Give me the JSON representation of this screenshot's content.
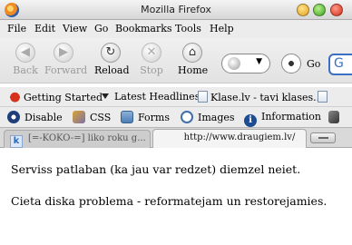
{
  "window": {
    "title": "Mozilla Firefox"
  },
  "menu": [
    "File",
    "Edit",
    "View",
    "Go",
    "Bookmarks",
    "Tools",
    "Help"
  ],
  "nav": {
    "back": "Back",
    "forward": "Forward",
    "reload": "Reload",
    "stop": "Stop",
    "home": "Home",
    "go": "Go"
  },
  "bookmarks": {
    "items": [
      "Getting Started",
      "Latest Headlines",
      "Klase.lv - tavi klases..."
    ]
  },
  "devbar": {
    "items": [
      "Disable",
      "CSS",
      "Forms",
      "Images",
      "Information"
    ]
  },
  "tabs": [
    {
      "label": "[=-KOKO-=] liko roku g...",
      "active": false
    },
    {
      "label": "http://www.draugiem.lv/",
      "active": true
    }
  ],
  "page": {
    "lines": [
      "Serviss patlaban (ka jau var redzet) diemzel neiet.",
      "Cieta diska problema - reformatejam un restorejamies."
    ]
  }
}
